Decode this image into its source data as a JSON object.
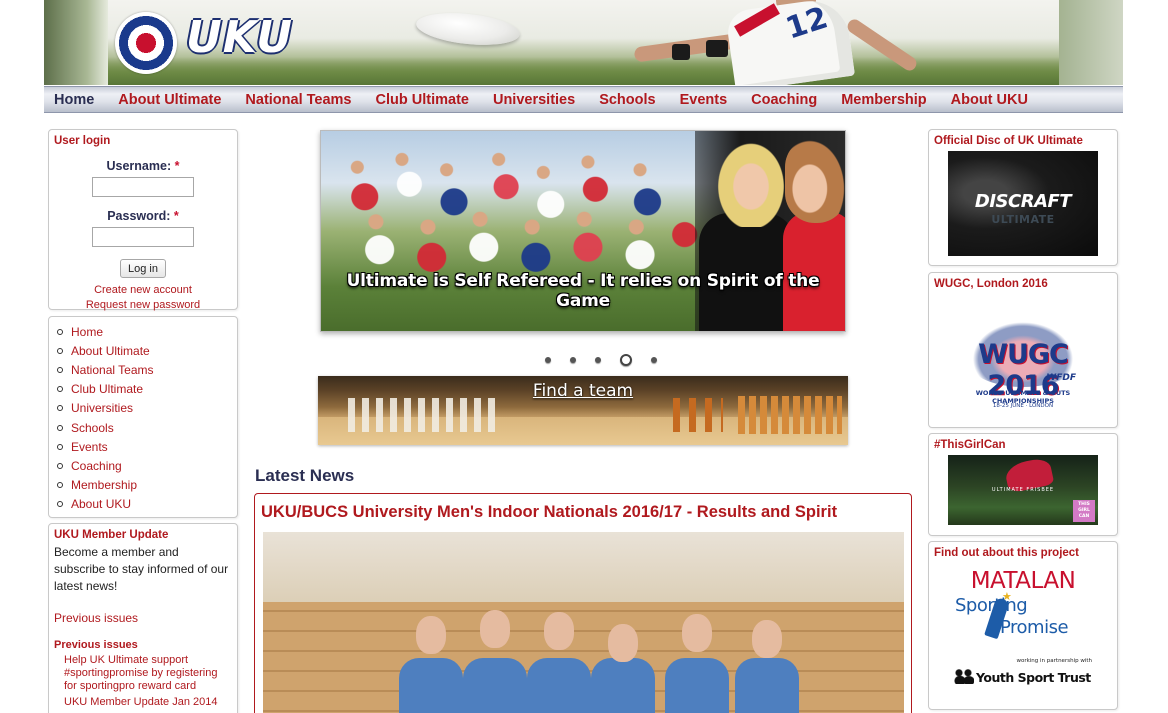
{
  "header": {
    "logo_text": "UKU",
    "player_number": "12"
  },
  "nav": {
    "items": [
      "Home",
      "About Ultimate",
      "National Teams",
      "Club Ultimate",
      "Universities",
      "Schools",
      "Events",
      "Coaching",
      "Membership",
      "About UKU"
    ],
    "active": "Home"
  },
  "login": {
    "title": "User login",
    "username_label": "Username:",
    "password_label": "Password:",
    "required_mark": "*",
    "username_value": "",
    "password_value": "",
    "submit_label": "Log in",
    "create_account": "Create new account",
    "request_password": "Request new password"
  },
  "sidebar_menu": {
    "items": [
      "Home",
      "About Ultimate",
      "National Teams",
      "Club Ultimate",
      "Universities",
      "Schools",
      "Events",
      "Coaching",
      "Membership",
      "About UKU"
    ]
  },
  "member_update": {
    "title": "UKU Member Update",
    "text": "Become a member and subscribe to stay informed of our latest news!",
    "previous_link": "Previous issues",
    "previous_heading": "Previous issues",
    "issues": [
      "Help UK Ultimate support #sportingpromise by registering for sportingpro reward card",
      "UKU Member Update Jan 2014"
    ]
  },
  "slideshow": {
    "caption": "Ultimate is Self Refereed - It relies on Spirit of the Game",
    "dot_count": 5,
    "active_dot": 4
  },
  "find_team": {
    "label": "Find a team"
  },
  "news": {
    "section_title": "Latest News",
    "article_title": "UKU/BUCS University Men's Indoor Nationals 2016/17 - Results and Spirit"
  },
  "right": {
    "disc": {
      "title": "Official Disc of UK Ultimate",
      "brand": "DISCRAFT",
      "sub": "ULTIMATE"
    },
    "wugc": {
      "title": "WUGC, London 2016",
      "logo": "WUGC 2016",
      "wfdf": "WFDF",
      "full": "WORLD ULTIMATE & GUTS CHAMPIONSHIPS",
      "date": "18-25 JUNE · LONDON"
    },
    "girl": {
      "title": "#ThisGirlCan",
      "caption": "ULTIMATE FRISBEE",
      "badge": "THIS GIRL CAN"
    },
    "matalan": {
      "title": "Find out about this project",
      "line1": "MATALAN",
      "line2": "Sporting",
      "line3": "Promise",
      "partner": "working in partnership with",
      "trust": "Youth Sport Trust"
    }
  },
  "colors": {
    "accent_red": "#b0191e",
    "nav_blue": "#2a2e52",
    "union_blue": "#1d3a8a"
  }
}
